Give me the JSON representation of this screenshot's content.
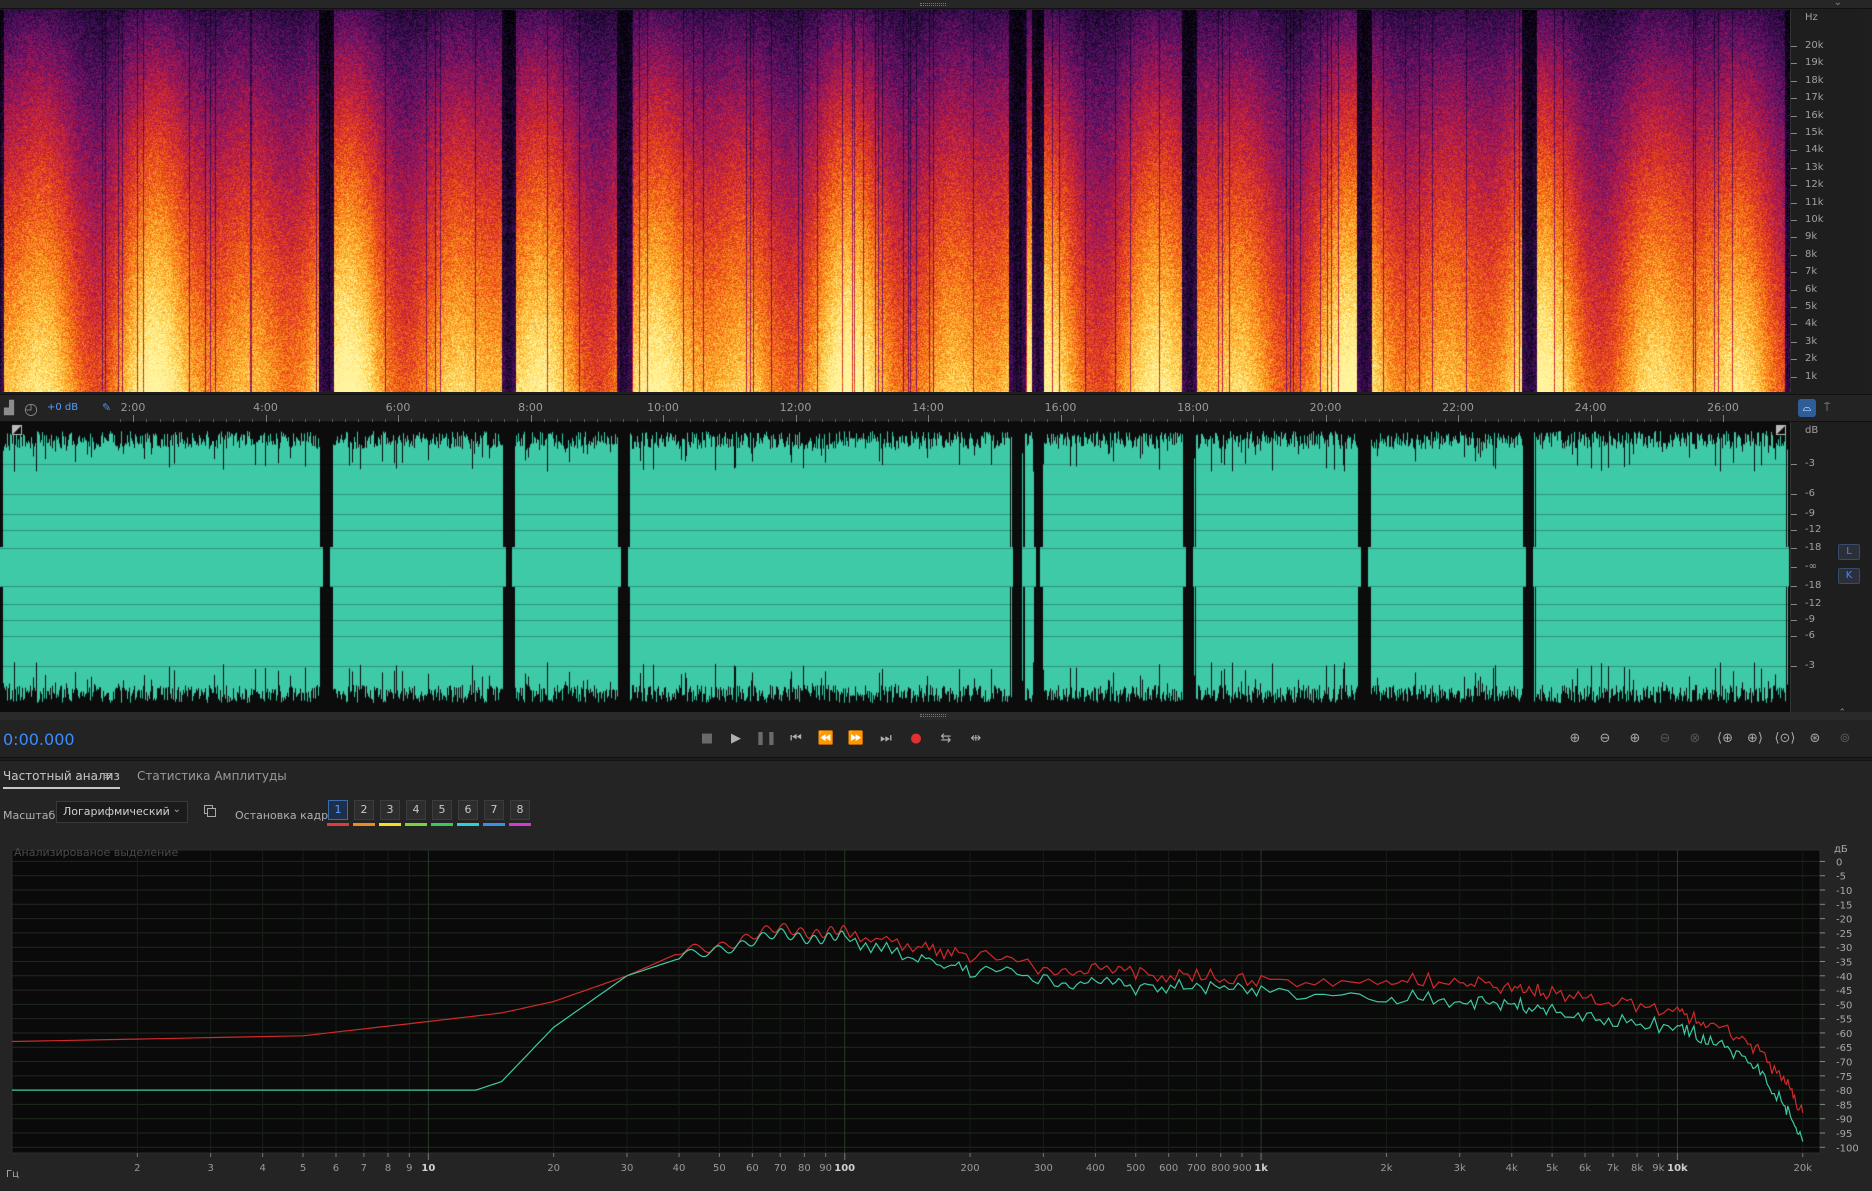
{
  "spectral": {
    "unit_label": "Hz",
    "freq_labels": [
      "20k",
      "19k",
      "18k",
      "17k",
      "16k",
      "15k",
      "14k",
      "13k",
      "12k",
      "11k",
      "10k",
      "9k",
      "8k",
      "7k",
      "6k",
      "5k",
      "4k",
      "3k",
      "2k",
      "1k"
    ]
  },
  "timeline": {
    "gain_label": "+0 dB",
    "time_labels": [
      "2:00",
      "4:00",
      "6:00",
      "8:00",
      "10:00",
      "12:00",
      "14:00",
      "16:00",
      "18:00",
      "20:00",
      "22:00",
      "24:00",
      "26:00"
    ]
  },
  "waveform": {
    "unit_label": "dB",
    "db_labels": [
      "-3",
      "-6",
      "-9",
      "-12",
      "-18",
      "-∞",
      "-18",
      "-12",
      "-9",
      "-6",
      "-3"
    ],
    "channel_left": "L",
    "channel_right": "K",
    "fill_color": "#3ec9a7"
  },
  "transport": {
    "current_time": "0:00.000"
  },
  "frequency_analysis": {
    "tab_active": "Частотный анализ",
    "tab_inactive": "Статистика Амплитуды",
    "tab_menu_icon": "≡",
    "scale_label": "Масштаб:",
    "scale_value": "Логарифмический",
    "freeze_label": "Остановка кадра:",
    "freeze_buttons": [
      "1",
      "2",
      "3",
      "4",
      "5",
      "6",
      "7",
      "8"
    ],
    "freeze_colors": [
      "#e23b3b",
      "#f08a1e",
      "#f0e01e",
      "#7cd23a",
      "#3ac85a",
      "#2ad2d6",
      "#3a8ef0",
      "#d23ad2"
    ],
    "selected_freeze": "1",
    "analyzed_label": "Анализированое выделение",
    "x_unit": "Гц",
    "y_unit": "дБ",
    "x_tick_labels": [
      "2",
      "3",
      "4",
      "5",
      "6",
      "7",
      "8",
      "9",
      "10",
      "20",
      "30",
      "40",
      "50",
      "60",
      "70",
      "80",
      "90",
      "100",
      "200",
      "300",
      "400",
      "500",
      "600",
      "700",
      "800",
      "900",
      "1k",
      "2k",
      "3k",
      "4k",
      "5k",
      "6k",
      "7k",
      "8k",
      "9k",
      "10k",
      "20k"
    ],
    "y_tick_labels": [
      "0",
      "-5",
      "-10",
      "-15",
      "-20",
      "-25",
      "-30",
      "-35",
      "-40",
      "-45",
      "-50",
      "-55",
      "-60",
      "-65",
      "-70",
      "-75",
      "-80",
      "-85",
      "-90",
      "-95",
      "-100"
    ]
  },
  "chart_data": {
    "type": "line",
    "xscale": "log",
    "xlim": [
      1,
      22000
    ],
    "ylim": [
      -102,
      4
    ],
    "xlabel": "Гц",
    "ylabel": "дБ",
    "grid": true,
    "series": [
      {
        "color": "#d02a2a",
        "x": [
          1,
          5,
          10,
          15,
          20,
          30,
          40,
          50,
          60,
          70,
          80,
          90,
          100,
          150,
          200,
          300,
          400,
          500,
          700,
          1000,
          2000,
          3000,
          4000,
          5000,
          7000,
          10000,
          12000,
          15000,
          18000,
          20000
        ],
        "y": [
          -63,
          -61,
          -56,
          -53,
          -49,
          -40,
          -32,
          -29,
          -26,
          -24,
          -24,
          -25,
          -25,
          -30,
          -33,
          -37,
          -38,
          -39,
          -40,
          -42,
          -41,
          -42,
          -44,
          -46,
          -49,
          -53,
          -56,
          -64,
          -76,
          -88
        ]
      },
      {
        "color": "#3ec9a0",
        "x": [
          1,
          5,
          10,
          13,
          15,
          20,
          30,
          40,
          50,
          60,
          70,
          80,
          90,
          100,
          150,
          200,
          300,
          400,
          500,
          700,
          1000,
          2000,
          3000,
          4000,
          5000,
          7000,
          10000,
          12000,
          15000,
          18000,
          20000
        ],
        "y": [
          -80,
          -80,
          -80,
          -80,
          -77,
          -58,
          -40,
          -34,
          -30,
          -28,
          -26,
          -26,
          -27,
          -27,
          -34,
          -38,
          -41,
          -43,
          -44,
          -44,
          -45,
          -47,
          -49,
          -50,
          -52,
          -56,
          -58,
          -62,
          -70,
          -85,
          -98
        ]
      }
    ]
  }
}
